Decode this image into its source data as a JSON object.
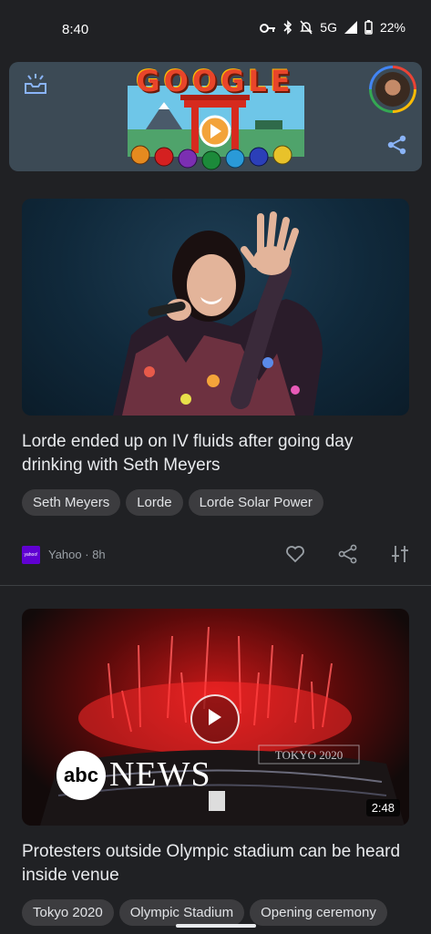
{
  "status_bar": {
    "time": "8:40",
    "network": "5G",
    "battery": "22%"
  },
  "doodle": {
    "logo_text": "GOOGLE"
  },
  "articles": [
    {
      "headline": "Lorde ended up on IV fluids after going day drinking with Seth Meyers",
      "chips": [
        "Seth Meyers",
        "Lorde",
        "Lorde Solar Power"
      ],
      "source_logo_text": "yahoo!",
      "source": "Yahoo",
      "age": "8h"
    },
    {
      "headline": "Protesters outside Olympic stadium can be heard inside venue",
      "chips": [
        "Tokyo 2020",
        "Olympic Stadium",
        "Opening ceremony"
      ],
      "video_duration": "2:48",
      "overlay_logo": "abc",
      "overlay_text": "NEWS",
      "stadium_sign": "TOKYO 2020"
    }
  ],
  "colors": {
    "background": "#202124",
    "doodle_bg": "#3c4a55",
    "chip_bg": "#3c3c3f",
    "accent": "#8ab4f8"
  }
}
